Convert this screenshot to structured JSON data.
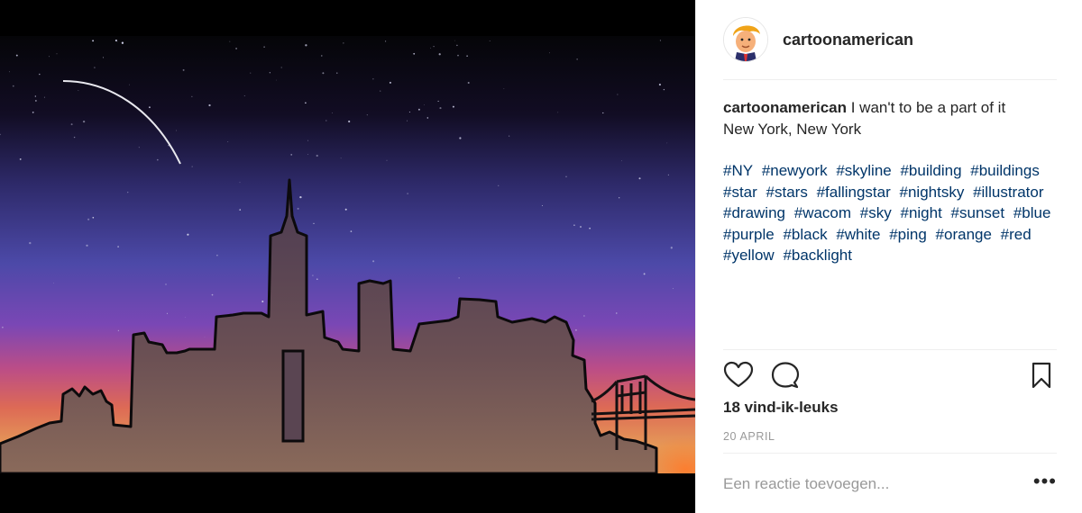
{
  "post": {
    "username": "cartoonamerican",
    "caption_user": "cartoonamerican",
    "caption_text": "I wan't to be a part of it",
    "caption_place": "New York, New York",
    "hashtags": [
      "#NY",
      "#newyork",
      "#skyline",
      "#building",
      "#buildings",
      "#star",
      "#stars",
      "#fallingstar",
      "#nightsky",
      "#illustrator",
      "#drawing",
      "#wacom",
      "#sky",
      "#night",
      "#sunset",
      "#blue",
      "#purple",
      "#black",
      "#white",
      "#ping",
      "#orange",
      "#red",
      "#yellow",
      "#backlight"
    ],
    "likes": "18 vind-ik-leuks",
    "date": "20 APRIL",
    "comment_placeholder": "Een reactie toevoegen...",
    "more_label": "•••"
  },
  "icons": {
    "like": "heart-icon",
    "comment": "comment-bubble-icon",
    "save": "bookmark-icon",
    "more": "more-options-icon"
  },
  "colors": {
    "hashtag": "#003569",
    "text": "#262626",
    "muted": "#999999"
  }
}
